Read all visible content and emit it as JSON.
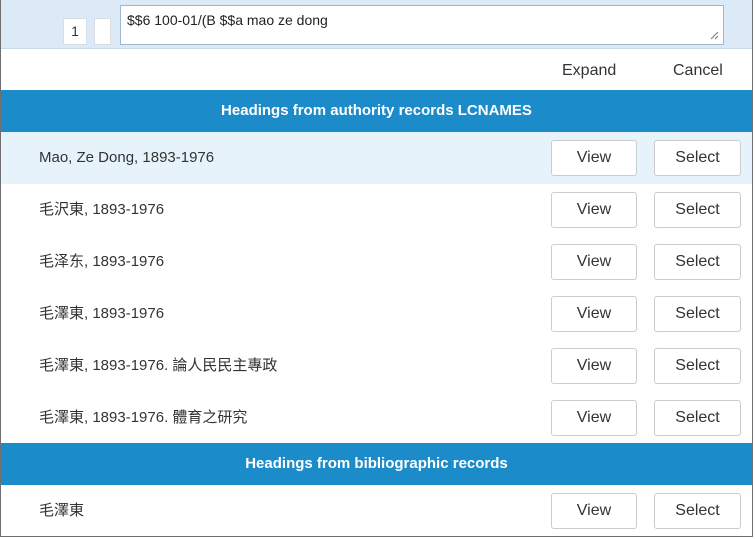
{
  "editor": {
    "line_number": "1",
    "field_value": "$$6 100-01/(B $$a mao ze dong"
  },
  "actions": {
    "expand_label": "Expand",
    "cancel_label": "Cancel"
  },
  "authority_section": {
    "title": "Headings from authority records LCNAMES",
    "rows": [
      {
        "label": "Mao, Ze Dong, 1893-1976",
        "view": "View",
        "select": "Select"
      },
      {
        "label": "毛沢東, 1893-1976",
        "view": "View",
        "select": "Select"
      },
      {
        "label": "毛泽东, 1893-1976",
        "view": "View",
        "select": "Select"
      },
      {
        "label": "毛澤東, 1893-1976",
        "view": "View",
        "select": "Select"
      },
      {
        "label": "毛澤東, 1893-1976. 論人民民主專政",
        "view": "View",
        "select": "Select"
      },
      {
        "label": "毛澤東, 1893-1976. 體育之研究",
        "view": "View",
        "select": "Select"
      }
    ]
  },
  "bib_section": {
    "title": "Headings from bibliographic records",
    "rows": [
      {
        "label": "毛澤東",
        "view": "View",
        "select": "Select"
      }
    ]
  },
  "colors": {
    "header_blue": "#1c8bca",
    "top_row_bg": "#dce9f7",
    "highlight_row_bg": "#e6f3fb"
  }
}
